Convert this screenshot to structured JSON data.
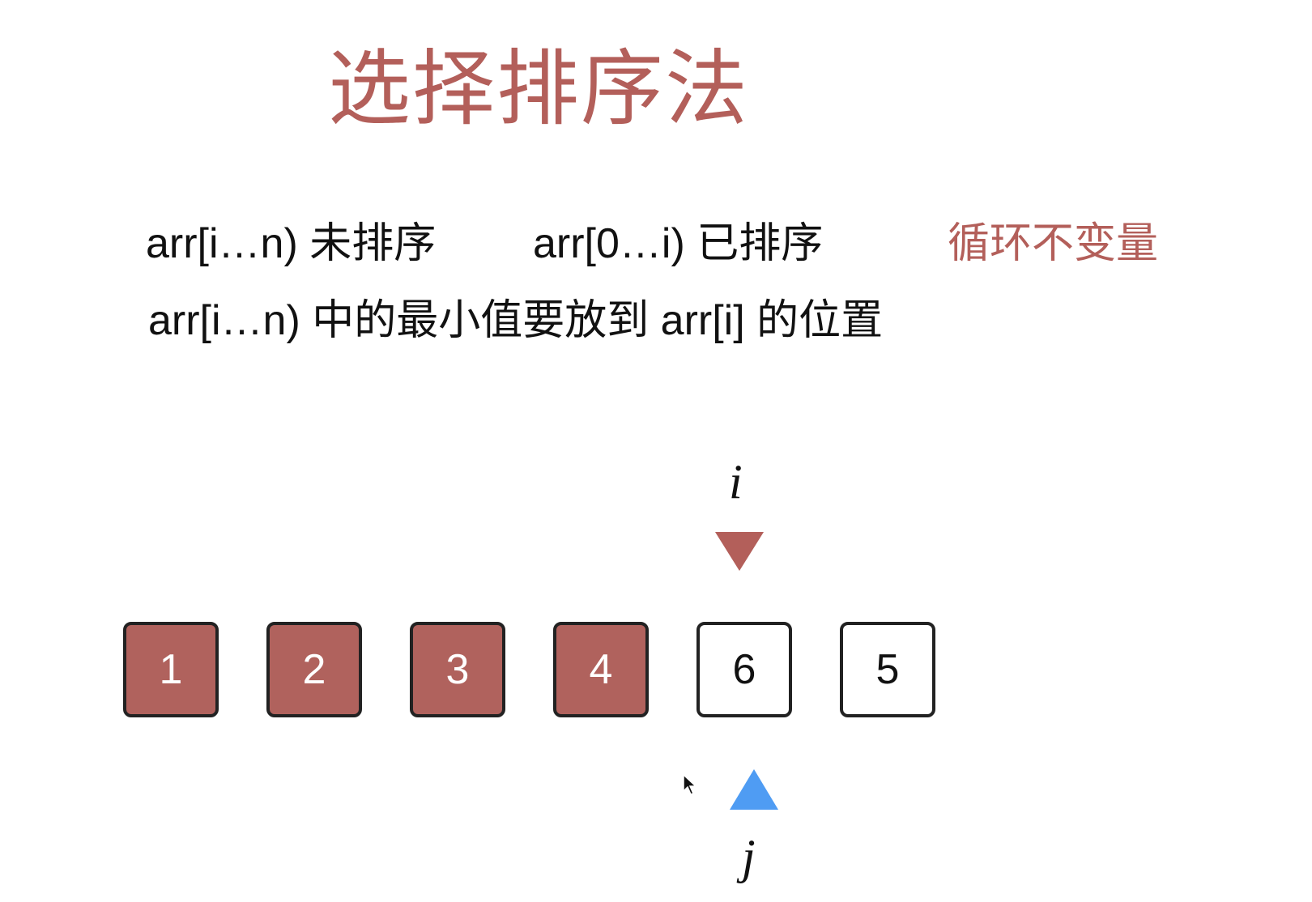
{
  "title": "选择排序法",
  "line1": {
    "unsorted": "arr[i…n) 未排序",
    "sorted": "arr[0…i) 已排序",
    "invariant": "循环不变量"
  },
  "line2": "arr[i…n) 中的最小值要放到 arr[i] 的位置",
  "pointers": {
    "i": {
      "label": "i",
      "color": "#b35f5a",
      "index": 4
    },
    "j": {
      "label": "j",
      "color": "#4f9cf3",
      "index": 4
    }
  },
  "array": [
    {
      "value": "1",
      "sorted": true
    },
    {
      "value": "2",
      "sorted": true
    },
    {
      "value": "3",
      "sorted": true
    },
    {
      "value": "4",
      "sorted": true
    },
    {
      "value": "6",
      "sorted": false
    },
    {
      "value": "5",
      "sorted": false
    }
  ],
  "colors": {
    "accent": "#b35f5a",
    "sorted_fill": "#b0625d",
    "pointer_j": "#4f9cf3"
  }
}
